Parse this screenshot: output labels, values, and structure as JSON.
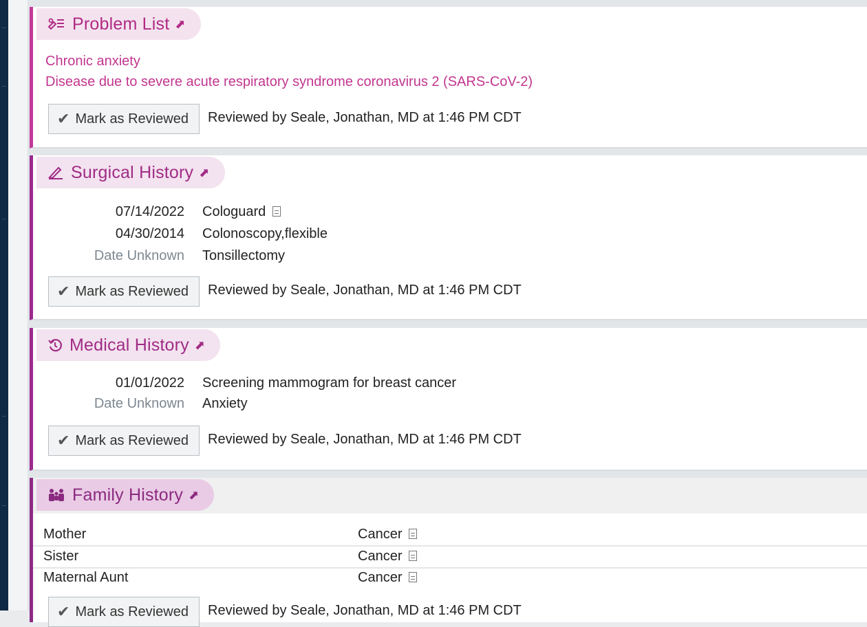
{
  "problem_list": {
    "title": "Problem List",
    "icon": "problem-list-icon",
    "items": [
      "Chronic anxiety",
      "Disease due to severe acute respiratory syndrome coronavirus 2 (SARS-CoV-2)"
    ],
    "review_button": "Mark as Reviewed",
    "reviewed_text": "Reviewed by Seale, Jonathan, MD at 1:46 PM CDT"
  },
  "surgical_history": {
    "title": "Surgical History",
    "icon": "scalpel-icon",
    "items": [
      {
        "date": "07/14/2022",
        "procedure": "Cologuard"
      },
      {
        "date": "04/30/2014",
        "procedure": "Colonoscopy,flexible"
      },
      {
        "date": "Date Unknown",
        "procedure": "Tonsillectomy"
      }
    ],
    "review_button": "Mark as Reviewed",
    "reviewed_text": "Reviewed by Seale, Jonathan, MD at 1:46 PM CDT"
  },
  "medical_history": {
    "title": "Medical History",
    "icon": "history-icon",
    "items": [
      {
        "date": "01/01/2022",
        "condition": "Screening mammogram for breast cancer"
      },
      {
        "date": "Date Unknown",
        "condition": "Anxiety"
      }
    ],
    "review_button": "Mark as Reviewed",
    "reviewed_text": "Reviewed by Seale, Jonathan, MD at 1:46 PM CDT"
  },
  "family_history": {
    "title": "Family History",
    "icon": "family-icon",
    "items": [
      {
        "relation": "Mother",
        "condition": "Cancer"
      },
      {
        "relation": "Sister",
        "condition": "Cancer"
      },
      {
        "relation": "Maternal Aunt",
        "condition": "Cancer"
      }
    ],
    "review_button": "Mark as Reviewed",
    "reviewed_text": "Reviewed by Seale, Jonathan, MD at 1:46 PM CDT"
  },
  "colors": {
    "accent": "#c2399a",
    "accent_dark": "#9b2a8e",
    "pill_bg": "#f4e3ee",
    "problem_text": "#c2368f"
  }
}
